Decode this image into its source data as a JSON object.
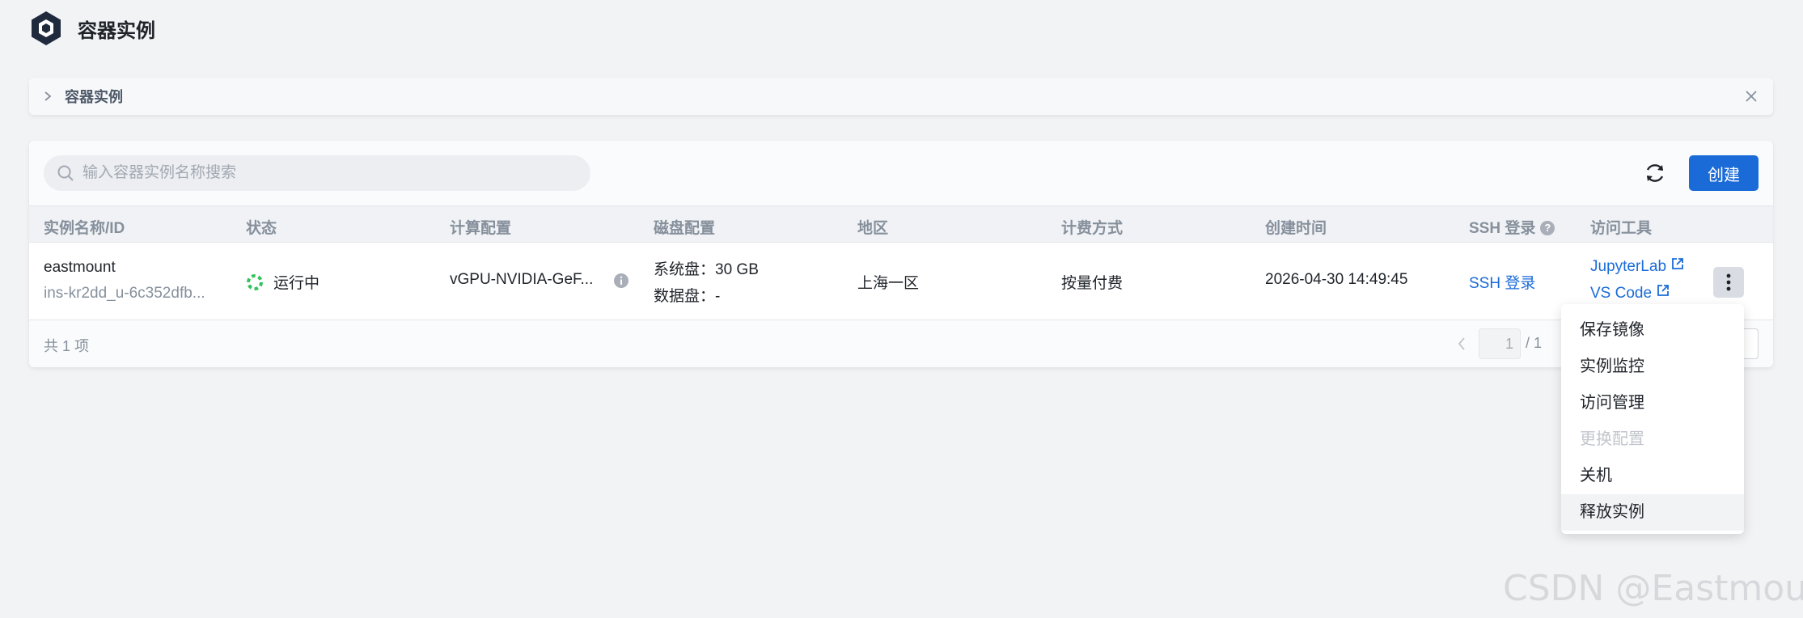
{
  "app": {
    "title": "容器实例",
    "logo_icon": "hexagon-logo-icon"
  },
  "breadcrumb": {
    "label": "容器实例"
  },
  "toolbar": {
    "search_placeholder": "输入容器实例名称搜索",
    "search_value": "",
    "create_label": "创建"
  },
  "table": {
    "columns": [
      "实例名称/ID",
      "状态",
      "计算配置",
      "磁盘配置",
      "地区",
      "计费方式",
      "创建时间",
      "SSH 登录",
      "访问工具"
    ],
    "rows": [
      {
        "name": "eastmount",
        "id": "ins-kr2dd_u-6c352dfb...",
        "status": "运行中",
        "compute": "vGPU-NVIDIA-GeF...",
        "disk_system": "系统盘：30 GB",
        "disk_data": "数据盘：-",
        "region": "上海一区",
        "billing": "按量付费",
        "created": "2026-04-30 14:49:45",
        "ssh": "SSH 登录",
        "tools": [
          "JupyterLab",
          "VS Code"
        ]
      }
    ]
  },
  "footer": {
    "total": "共 1 项",
    "page_current": "1",
    "page_total": "/ 1"
  },
  "menu": {
    "items": [
      {
        "label": "保存镜像",
        "disabled": false
      },
      {
        "label": "实例监控",
        "disabled": false
      },
      {
        "label": "访问管理",
        "disabled": false
      },
      {
        "label": "更换配置",
        "disabled": true
      },
      {
        "label": "关机",
        "disabled": false
      },
      {
        "label": "释放实例",
        "disabled": false
      }
    ]
  },
  "watermark": "CSDN @Eastmount",
  "colors": {
    "primary": "#1a6bd8",
    "running": "#2fc25b",
    "background": "#f2f3f5"
  }
}
